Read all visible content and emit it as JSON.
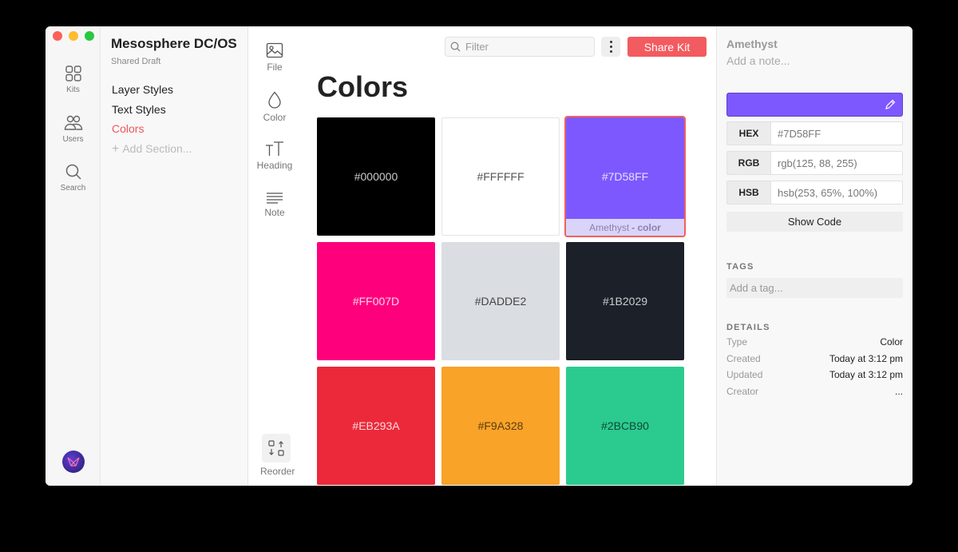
{
  "rail": {
    "items": [
      {
        "label": "Kits",
        "icon": "grid-icon"
      },
      {
        "label": "Users",
        "icon": "users-icon"
      },
      {
        "label": "Search",
        "icon": "search-icon"
      }
    ]
  },
  "sidebar": {
    "kit_title": "Mesosphere DC/OS",
    "kit_subtitle": "Shared Draft",
    "sections": [
      "Layer Styles",
      "Text Styles",
      "Colors"
    ],
    "add_section": "Add Section..."
  },
  "tools": {
    "items": [
      {
        "label": "File",
        "icon": "image-icon"
      },
      {
        "label": "Color",
        "icon": "droplet-icon"
      },
      {
        "label": "Heading",
        "icon": "heading-icon"
      },
      {
        "label": "Note",
        "icon": "note-icon"
      }
    ],
    "reorder": "Reorder"
  },
  "toolbar": {
    "filter_placeholder": "Filter",
    "share_label": "Share Kit"
  },
  "main": {
    "title": "Colors",
    "swatches": [
      {
        "hex": "#000000",
        "text_color": "#cccccc"
      },
      {
        "hex": "#FFFFFF",
        "text_color": "#555555"
      },
      {
        "hex": "#7D58FF",
        "text_color": "#e6e0ff",
        "selected": true,
        "caption_name": "Amethyst",
        "caption_type": "- color"
      },
      {
        "hex": "#FF007D",
        "text_color": "#ffd6ea"
      },
      {
        "hex": "#DADDE2",
        "text_color": "#444444"
      },
      {
        "hex": "#1B2029",
        "text_color": "#cccccc"
      },
      {
        "hex": "#EB293A",
        "text_color": "#ffd9dc"
      },
      {
        "hex": "#F9A328",
        "text_color": "#5a3d10"
      },
      {
        "hex": "#2BCB90",
        "text_color": "#0f4a34"
      }
    ]
  },
  "inspector": {
    "name": "Amethyst",
    "note_placeholder": "Add a note...",
    "color": "#7D58FF",
    "hex_label": "HEX",
    "hex_value": "#7D58FF",
    "rgb_label": "RGB",
    "rgb_value": "rgb(125, 88, 255)",
    "hsb_label": "HSB",
    "hsb_value": "hsb(253, 65%, 100%)",
    "show_code": "Show Code",
    "tags_heading": "TAGS",
    "tag_placeholder": "Add a tag...",
    "details_heading": "DETAILS",
    "details": [
      {
        "key": "Type",
        "value": "Color"
      },
      {
        "key": "Created",
        "value": "Today at 3:12 pm"
      },
      {
        "key": "Updated",
        "value": "Today at 3:12 pm"
      },
      {
        "key": "Creator",
        "value": "..."
      }
    ]
  }
}
